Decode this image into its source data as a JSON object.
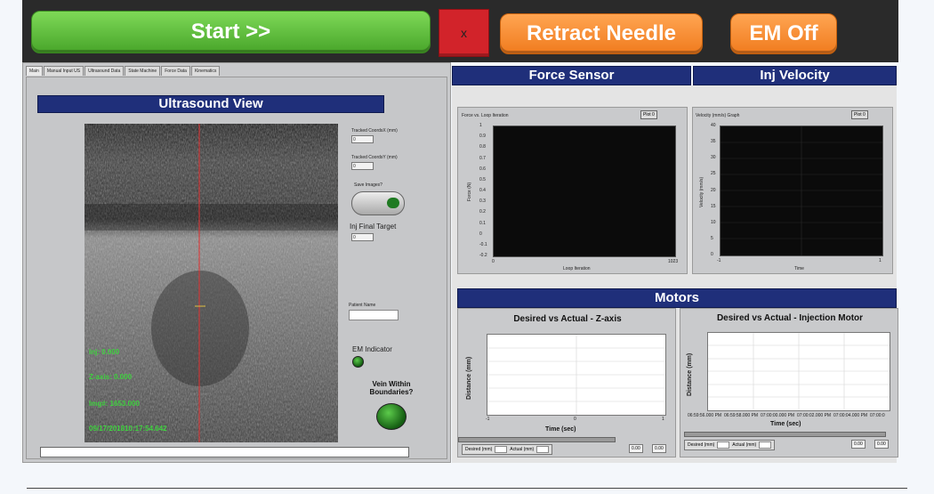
{
  "toolbar": {
    "start_label": "Start >>",
    "x_label": "x",
    "retract_label": "Retract Needle",
    "em_label": "EM Off",
    "start_color": "#55b336",
    "stop_color": "#d2232a",
    "orange_color": "#f58a2a"
  },
  "tabs": [
    "Main",
    "Manual Input US",
    "Ultrasound Data",
    "State Machine",
    "Force Data",
    "Kinematics"
  ],
  "ultrasound": {
    "title": "Ultrasound View",
    "overlay": {
      "inj": "Inj: 0.000",
      "zaxis": "Z-axis:  0.000",
      "img": "Img#: 1653.000",
      "timestamp": "09/17/201810:17:54.642"
    }
  },
  "controls": {
    "tracked_x_label": "Tracked CoordsX (mm)",
    "tracked_x_value": "0",
    "tracked_y_label": "Tracked CoordsY (mm)",
    "tracked_y_value": "0",
    "save_images_label": "Save Images?",
    "inj_final_target_label": "Inj Final Target",
    "inj_final_target_value": "0",
    "patient_name_label": "Patient Name",
    "em_indicator_label": "EM Indicator",
    "vein_label": "Vein Within Boundaries?"
  },
  "force_sensor": {
    "header": "Force Sensor",
    "graph_title": "Force vs. Loop Iteration",
    "plot_button": "Plot 0",
    "ylabel": "Force (N)",
    "xlabel": "Loop Iteration",
    "y_ticks": [
      "1",
      "0.9",
      "0.8",
      "0.7",
      "0.6",
      "0.5",
      "0.4",
      "0.3",
      "0.2",
      "0.1",
      "0",
      "-0.1",
      "-0.2"
    ],
    "x_ticks": [
      "0",
      "1023"
    ]
  },
  "inj_velocity": {
    "header": "Inj Velocity",
    "graph_title": "Velocity (mm/s) Graph",
    "plot_button": "Plot 0",
    "ylabel": "Velocity (mm/s)",
    "xlabel": "Time",
    "y_ticks": [
      "40",
      "35",
      "30",
      "25",
      "20",
      "15",
      "10",
      "5",
      "0"
    ],
    "x_ticks": [
      "-1",
      "1"
    ]
  },
  "motors": {
    "header": "Motors",
    "z_axis": {
      "title": "Desired vs Actual - Z-axis",
      "ylabel": "Distance (mm)",
      "xlabel": "Time (sec)",
      "x_ticks": [
        "-1",
        "0",
        "1"
      ],
      "legend_desired": "Desired (mm)",
      "legend_actual": "Actual (mm)",
      "val1": "0.00",
      "val2": "0.00"
    },
    "injection": {
      "title": "Desired vs Actual - Injection Motor",
      "ylabel": "Distance (mm)",
      "xlabel": "Time (sec)",
      "x_ticks": [
        "06:59:56.000 PM",
        "06:59:58.000 PM",
        "07:00:00.000 PM",
        "07:00:02.000 PM",
        "07:00:04.000 PM",
        "07:00:0"
      ],
      "legend_desired": "Desired (mm)",
      "legend_actual": "Actual (mm)",
      "val1": "0.00",
      "val2": "0.00"
    }
  }
}
